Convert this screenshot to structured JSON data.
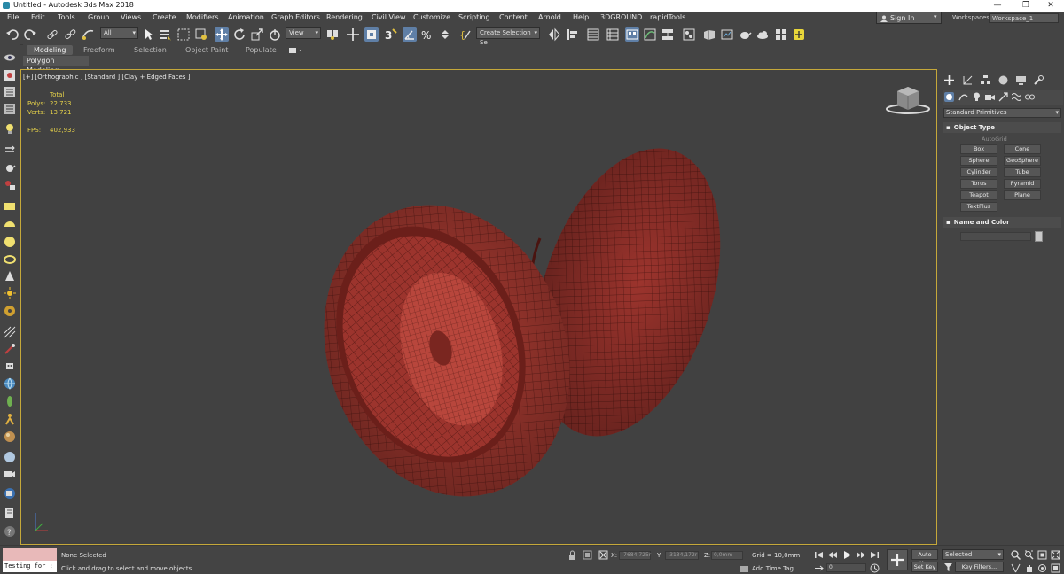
{
  "window": {
    "title": "Untitled - Autodesk 3ds Max 2018",
    "minimize": "—",
    "restore": "❐",
    "close": "✕"
  },
  "menu": {
    "items": [
      "File",
      "Edit",
      "Tools",
      "Group",
      "Views",
      "Create",
      "Modifiers",
      "Animation",
      "Graph Editors",
      "Rendering",
      "Civil View",
      "Customize",
      "Scripting",
      "Content",
      "Arnold",
      "Help",
      "3DGROUND",
      "rapidTools"
    ],
    "sign_in": "Sign In",
    "workspaces_label": "Workspaces:",
    "workspace_value": "Workspace_1"
  },
  "toolbar": {
    "selection_filter": "All",
    "ref_coord": "View",
    "named_selection": "Create Selection Se",
    "active_color": "#5f7fa6"
  },
  "ribbon": {
    "tabs": [
      "Modeling",
      "Freeform",
      "Selection",
      "Object Paint",
      "Populate"
    ],
    "active_tab": "Modeling",
    "panel_label": "Polygon Modeling"
  },
  "viewport": {
    "label": "[+] [Orthographic ] [Standard ] [Clay + Edged Faces ]",
    "stats": {
      "total_label": "Total",
      "polys_label": "Polys:",
      "polys_value": "22 733",
      "verts_label": "Verts:",
      "verts_value": "13 721",
      "fps_label": "FPS:",
      "fps_value": "402,933"
    },
    "border_color": "#c5a83a",
    "mesh_color": "#a83a32"
  },
  "command_panel": {
    "category": "Standard Primitives",
    "object_type_title": "Object Type",
    "autogrid": "AutoGrid",
    "primitives": [
      "Box",
      "Cone",
      "Sphere",
      "GeoSphere",
      "Cylinder",
      "Tube",
      "Torus",
      "Pyramid",
      "Teapot",
      "Plane",
      "TextPlus"
    ],
    "name_color_title": "Name and Color",
    "rollout_icon": "▪"
  },
  "status": {
    "maxscript_text": "Testing for :",
    "selection_status": "None Selected",
    "prompt": "Click and drag to select and move objects",
    "x_label": "X:",
    "x_value": "-7684,725r",
    "y_label": "Y:",
    "y_value": "-3134,172r",
    "z_label": "Z:",
    "z_value": "0,0mm",
    "grid": "Grid = 10,0mm",
    "add_time_tag": "Add Time Tag",
    "auto_key": "Auto Key",
    "set_key": "Set Key",
    "selected": "Selected",
    "key_filters": "Key Filters...",
    "frame": "0"
  }
}
